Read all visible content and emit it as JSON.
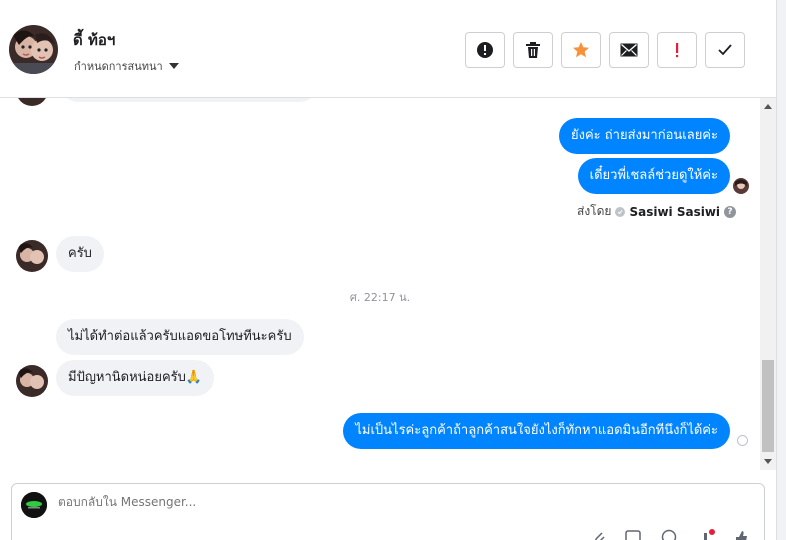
{
  "header": {
    "contact_name": "ดี้ ท้อฯ",
    "assign_label": "กำหนดการสนทนา",
    "actions": [
      {
        "name": "mark-spam-button",
        "icon": "alert-circle-icon"
      },
      {
        "name": "delete-button",
        "icon": "trash-icon"
      },
      {
        "name": "star-button",
        "icon": "star-icon"
      },
      {
        "name": "mark-unread-button",
        "icon": "envelope-icon"
      },
      {
        "name": "follow-up-button",
        "icon": "exclamation-icon"
      },
      {
        "name": "mark-done-button",
        "icon": "check-icon"
      }
    ]
  },
  "messages": {
    "out1": "ยังค่ะ ถ่ายส่งมาก่อนเลยค่ะ",
    "out2": "เดี๋ยวพี่เชลล์ช่วยดูให้ค่ะ",
    "sent_by_prefix": "ส่งโดย",
    "sent_by_name": "Sasiwi Sasiwi",
    "in1": "ครับ",
    "timestamp": "ศ. 22:17 น.",
    "in2": "ไม่ได้ทำต่อแล้วครับแอดขอโทษทีนะครับ",
    "in3": "มีปัญหานิดหน่อยครับ🙏",
    "out3": "ไม่เป็นไรค่ะลูกค้าถ้าลูกค้าสนใจยังไงก็ทักหาแอดมินอีกทีนึงก็ได้ค่ะ"
  },
  "reply": {
    "placeholder": "ตอบกลับใน Messenger..."
  },
  "colors": {
    "outgoing_bubble": "#0084ff",
    "incoming_bubble": "#f0f2f5",
    "star": "#f7923b",
    "follow_up": "#e41e3f"
  }
}
